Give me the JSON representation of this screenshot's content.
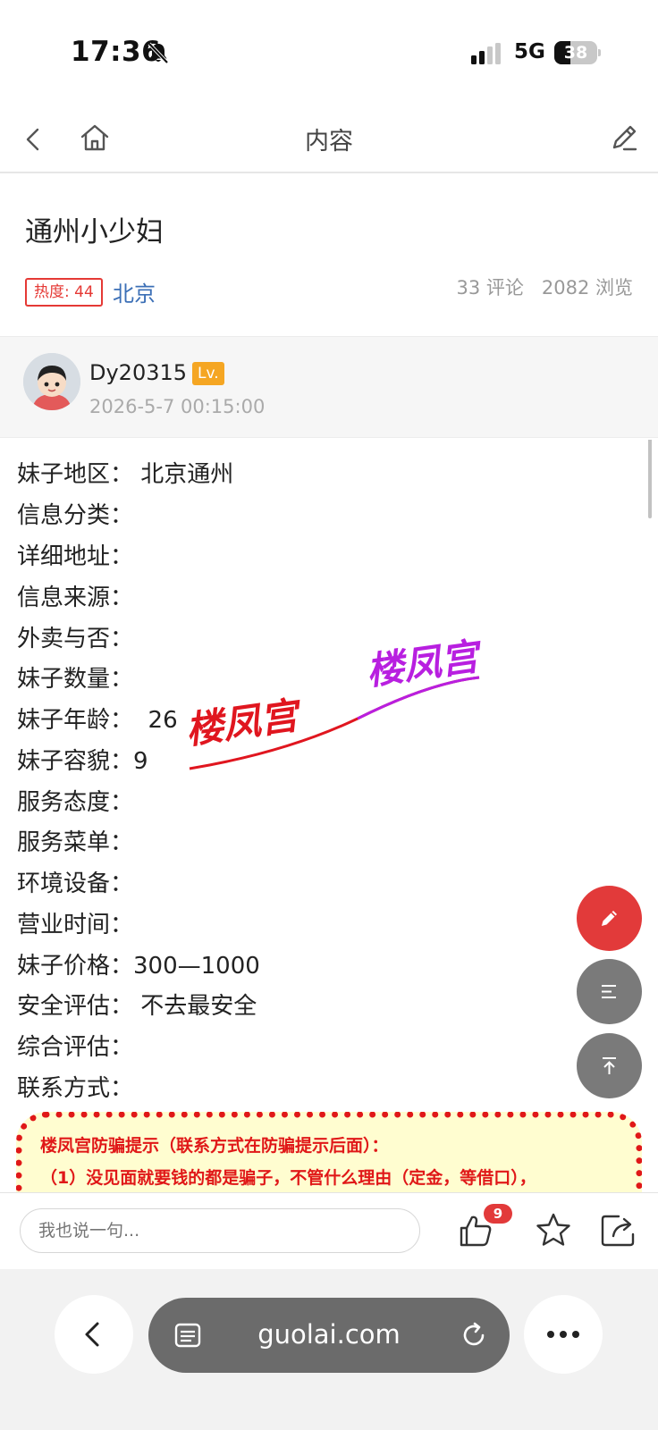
{
  "status_bar": {
    "time": "17:36",
    "network": "5G",
    "battery_percent": "38",
    "battery_level": 0.38
  },
  "nav": {
    "title": "内容"
  },
  "post": {
    "title": "通州小少妇",
    "heat_badge": "热度: 44",
    "region": "北京",
    "comments": "33 评论",
    "views": "2082 浏览"
  },
  "author": {
    "name": "Dy20315",
    "level": "Lv.",
    "time": "2026-5-7 00:15:00"
  },
  "fields": [
    {
      "label": "妹子地区：",
      "value": " 北京通州"
    },
    {
      "label": "信息分类：",
      "value": ""
    },
    {
      "label": "详细地址：",
      "value": ""
    },
    {
      "label": "信息来源：",
      "value": ""
    },
    {
      "label": "外卖与否：",
      "value": ""
    },
    {
      "label": "妹子数量：",
      "value": ""
    },
    {
      "label": "妹子年龄：",
      "value": "  26"
    },
    {
      "label": "妹子容貌：",
      "value": "9"
    },
    {
      "label": "服务态度：",
      "value": ""
    },
    {
      "label": "服务菜单：",
      "value": ""
    },
    {
      "label": "环境设备：",
      "value": ""
    },
    {
      "label": "营业时间：",
      "value": ""
    },
    {
      "label": "妹子价格：",
      "value": "300—1000"
    },
    {
      "label": "安全评估：",
      "value": " 不去最安全"
    },
    {
      "label": "综合评估：",
      "value": ""
    },
    {
      "label": "联系方式：",
      "value": ""
    }
  ],
  "watermark": {
    "text_1": "楼凤宫",
    "text_2": "楼凤宫",
    "color_1": "#e0161f",
    "color_2": "#b81fe0"
  },
  "notice": {
    "line_1": "楼凤宫防骗提示（联系方式在防骗提示后面）：",
    "line_2": "（1）没见面就要钱的都是骗子，不管什么理由（定金，等借口），"
  },
  "comment_bar": {
    "placeholder": "我也说一句...",
    "like_count": "9"
  },
  "browser": {
    "url": "guolai.com"
  },
  "colors": {
    "accent_red": "#e23a3a",
    "link_blue": "#3b6fb6",
    "level_orange": "#f5a623"
  },
  "icons": [
    "bell-slash-icon",
    "signal-icon",
    "battery-icon",
    "back-icon",
    "home-icon",
    "edit-icon",
    "pencil-icon",
    "list-icon",
    "to-top-icon",
    "like-icon",
    "star-icon",
    "share-icon",
    "tabs-icon",
    "reload-icon",
    "more-icon"
  ]
}
